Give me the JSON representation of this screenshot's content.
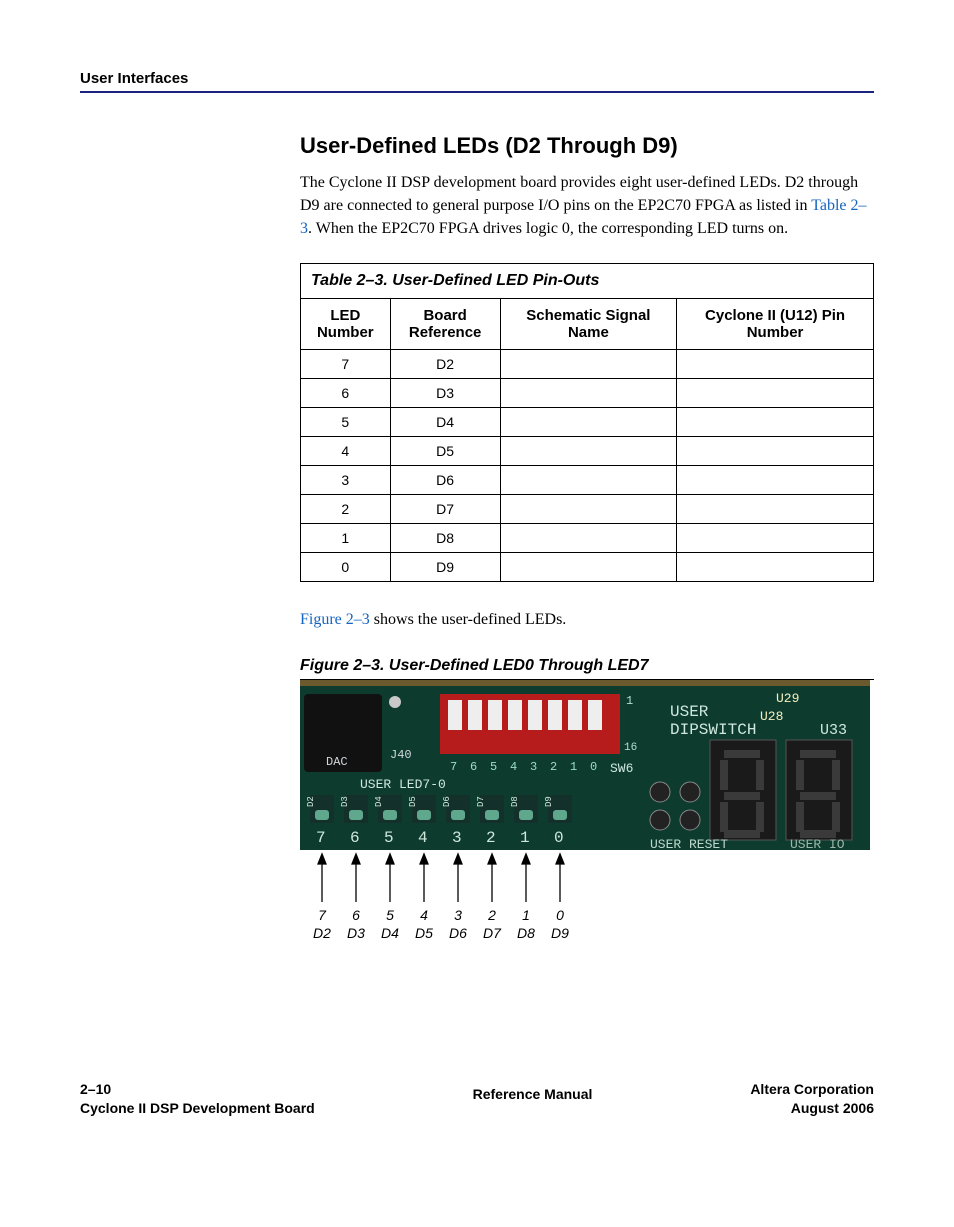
{
  "header": {
    "section_label": "User Interfaces"
  },
  "section": {
    "title": "User-Defined LEDs (D2 Through D9)",
    "para1_a": "The Cyclone II DSP development board provides eight user-defined LEDs. D2 through D9 are connected to general purpose I/O pins on the EP2C70 FPGA as listed in ",
    "para1_xref": "Table 2–3",
    "para1_b": ". When the EP2C70 FPGA drives logic 0, the corresponding LED turns on.",
    "fig_intro_xref": "Figure 2–3",
    "fig_intro_b": " shows the user-defined LEDs."
  },
  "table": {
    "caption": "Table 2–3. User-Defined LED Pin-Outs",
    "headers": {
      "c1a": "LED",
      "c1b": "Number",
      "c2a": "Board",
      "c2b": "Reference",
      "c3a": "Schematic Signal",
      "c3b": "Name",
      "c4a": "Cyclone II (U12) Pin",
      "c4b": "Number"
    },
    "rows": [
      {
        "led": "7",
        "ref": "D2",
        "sig": "",
        "pin": ""
      },
      {
        "led": "6",
        "ref": "D3",
        "sig": "",
        "pin": ""
      },
      {
        "led": "5",
        "ref": "D4",
        "sig": "",
        "pin": ""
      },
      {
        "led": "4",
        "ref": "D5",
        "sig": "",
        "pin": ""
      },
      {
        "led": "3",
        "ref": "D6",
        "sig": "",
        "pin": ""
      },
      {
        "led": "2",
        "ref": "D7",
        "sig": "",
        "pin": ""
      },
      {
        "led": "1",
        "ref": "D8",
        "sig": "",
        "pin": ""
      },
      {
        "led": "0",
        "ref": "D9",
        "sig": "",
        "pin": ""
      }
    ]
  },
  "figure": {
    "caption": "Figure 2–3. User-Defined LED0 Through LED7",
    "callouts": [
      {
        "top": "7",
        "bot": "D2"
      },
      {
        "top": "6",
        "bot": "D3"
      },
      {
        "top": "5",
        "bot": "D4"
      },
      {
        "top": "4",
        "bot": "D5"
      },
      {
        "top": "3",
        "bot": "D6"
      },
      {
        "top": "2",
        "bot": "D7"
      },
      {
        "top": "1",
        "bot": "D8"
      },
      {
        "top": "0",
        "bot": "D9"
      }
    ],
    "board_text": {
      "user": "USER",
      "dipswitch": "DIPSWITCH",
      "u29": "U29",
      "u28": "U28",
      "u33": "U33",
      "j40": "J40",
      "sw6": "SW6",
      "userled": "USER LED7-0",
      "userreset": "USER RESET",
      "userio": "USER IO",
      "dac": "DAC",
      "silkrow": [
        "7",
        "6",
        "5",
        "4",
        "3",
        "2",
        "1",
        "0"
      ],
      "dip_nums": [
        "7",
        "6",
        "5",
        "4",
        "3",
        "2",
        "1",
        "0"
      ],
      "led_refs": [
        "D2",
        "D3",
        "D4",
        "D5",
        "D6",
        "D7",
        "D8",
        "D9"
      ],
      "one": "1",
      "sixteen": "16"
    }
  },
  "footer": {
    "page": "2–10",
    "product": "Cyclone II DSP Development Board",
    "center": "Reference Manual",
    "company": "Altera Corporation",
    "date": "August 2006"
  }
}
